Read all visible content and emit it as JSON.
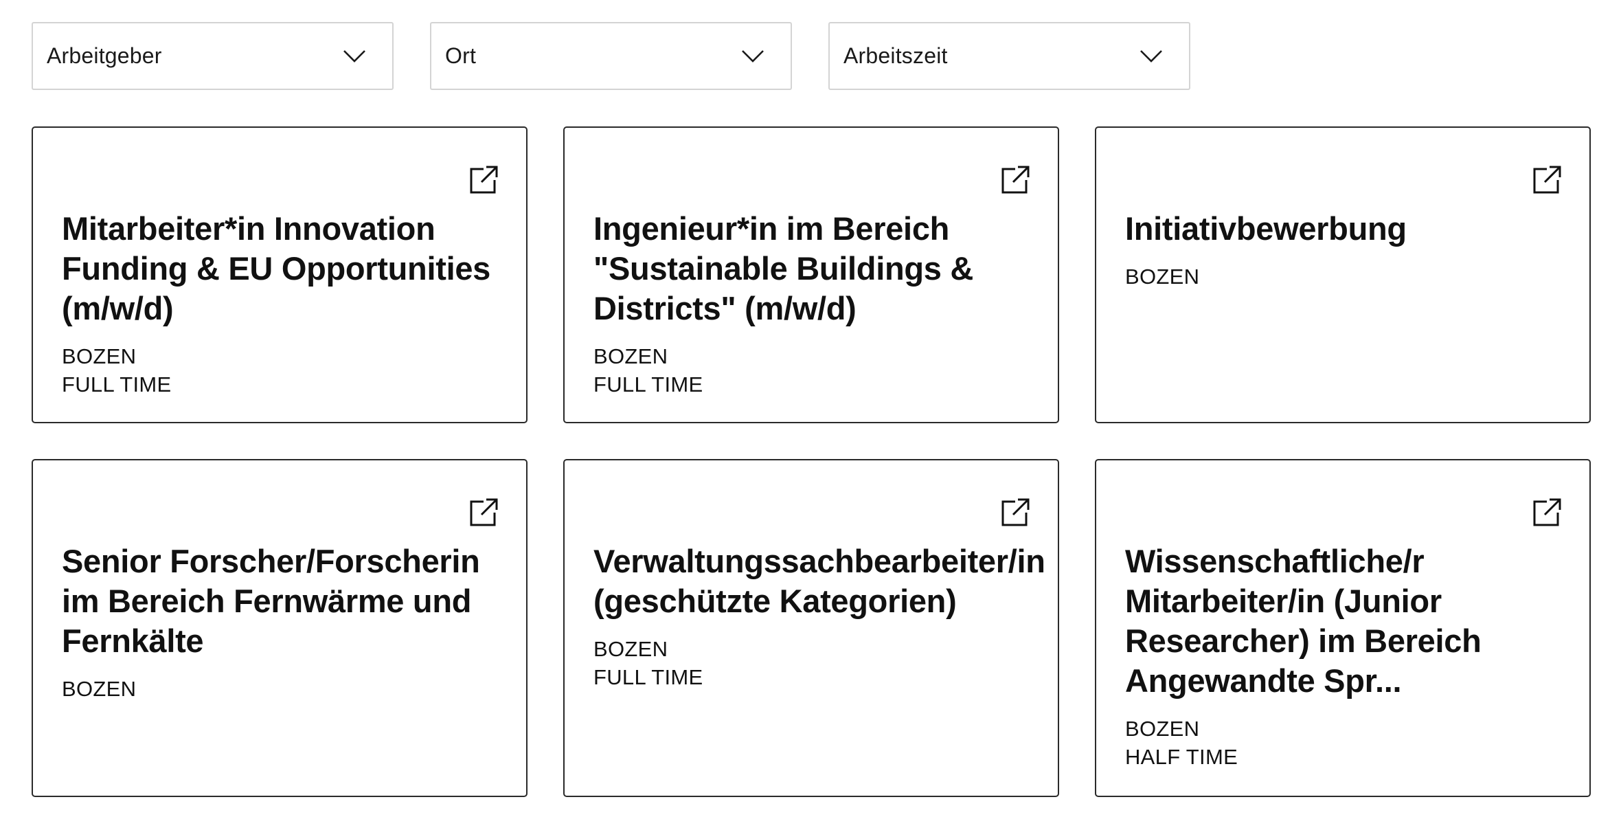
{
  "filters": [
    {
      "label": "Arbeitgeber",
      "icon": "chevron-down-icon"
    },
    {
      "label": "Ort",
      "icon": "chevron-down-icon"
    },
    {
      "label": "Arbeitszeit",
      "icon": "chevron-down-icon"
    }
  ],
  "jobs": [
    {
      "title": "Mitarbeiter*in Innovation Funding & EU Opportunities (m/w/d)",
      "location": "BOZEN",
      "time": "FULL TIME",
      "icon": "external-link-icon"
    },
    {
      "title": "Ingenieur*in im Bereich \"Sustainable Buildings & Districts\" (m/w/d)",
      "location": "BOZEN",
      "time": "FULL TIME",
      "icon": "external-link-icon"
    },
    {
      "title": "Initiativbewerbung",
      "location": "BOZEN",
      "time": "",
      "icon": "external-link-icon"
    },
    {
      "title": "Senior Forscher/Forscherin im Bereich Fernwärme und Fernkälte",
      "location": "BOZEN",
      "time": "",
      "icon": "external-link-icon"
    },
    {
      "title": "Verwaltungssachbearbeiter/in (geschützte Kategorien)",
      "location": "BOZEN",
      "time": "FULL TIME",
      "icon": "external-link-icon"
    },
    {
      "title": "Wissenschaftliche/r Mitarbeiter/in (Junior Researcher) im Bereich Angewandte Spr...",
      "location": "BOZEN",
      "time": "HALF TIME",
      "icon": "external-link-icon"
    }
  ],
  "colors": {
    "card_border": "#2a2a2a",
    "filter_border": "#d4d4d4",
    "text": "#111111"
  }
}
